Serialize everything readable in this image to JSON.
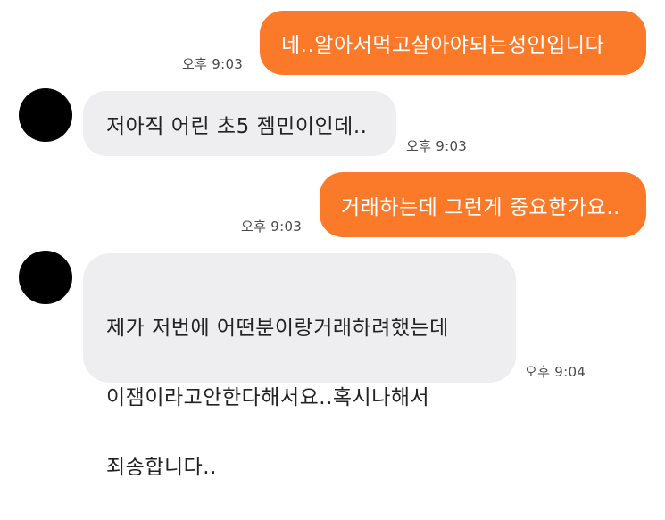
{
  "messages": [
    {
      "id": "msg-1",
      "direction": "outgoing",
      "text": "네..알아서먹고살아야되는성인입니다",
      "time": "오후 9:03"
    },
    {
      "id": "msg-2",
      "direction": "incoming",
      "text": "저아직 어린 초5 젬민이인데..",
      "time": "오후 9:03"
    },
    {
      "id": "msg-3",
      "direction": "outgoing",
      "text": "거래하는데 그런게 중요한가요..",
      "time": "오후 9:03"
    },
    {
      "id": "msg-4",
      "direction": "incoming",
      "lines": [
        "제가 저번에 어떤분이랑거래하려했는데",
        "이잼이라고안한다해서요..혹시나해서",
        "죄송합니다.."
      ],
      "time": "오후 9:04"
    }
  ],
  "colors": {
    "outgoing_bubble": "#fb7a2a",
    "incoming_bubble": "#eeeef1",
    "avatar": "#000000",
    "background": "#ffffff"
  }
}
